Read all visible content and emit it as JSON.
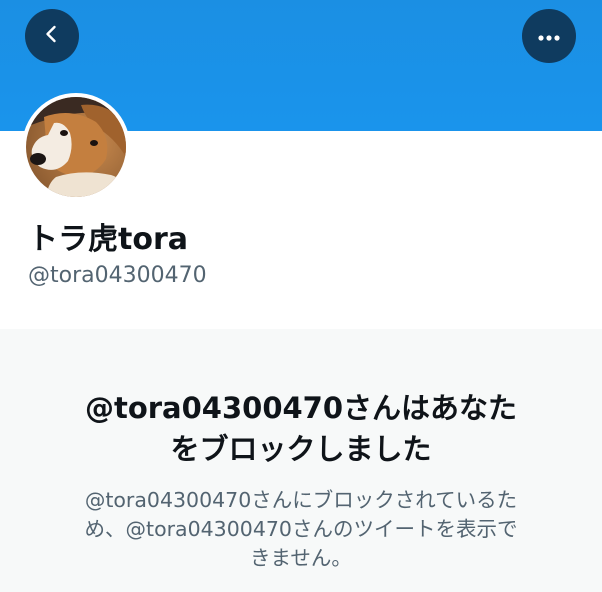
{
  "header": {
    "banner_color": "#1b8fe3",
    "back_button_icon": "chevron-left-icon",
    "more_button_icon": "more-horizontal-icon"
  },
  "profile": {
    "display_name": "トラ虎tora",
    "handle": "@tora04300470",
    "avatar_icon": "dog-avatar-image"
  },
  "blocked_notice": {
    "title_line1": "@tora04300470さんはあなた",
    "title_line2": "をブロックしました",
    "description_line1": "@tora04300470さんにブロックされているた",
    "description_line2": "め、@tora04300470さんのツイートを表示で",
    "description_line3": "きません。"
  }
}
